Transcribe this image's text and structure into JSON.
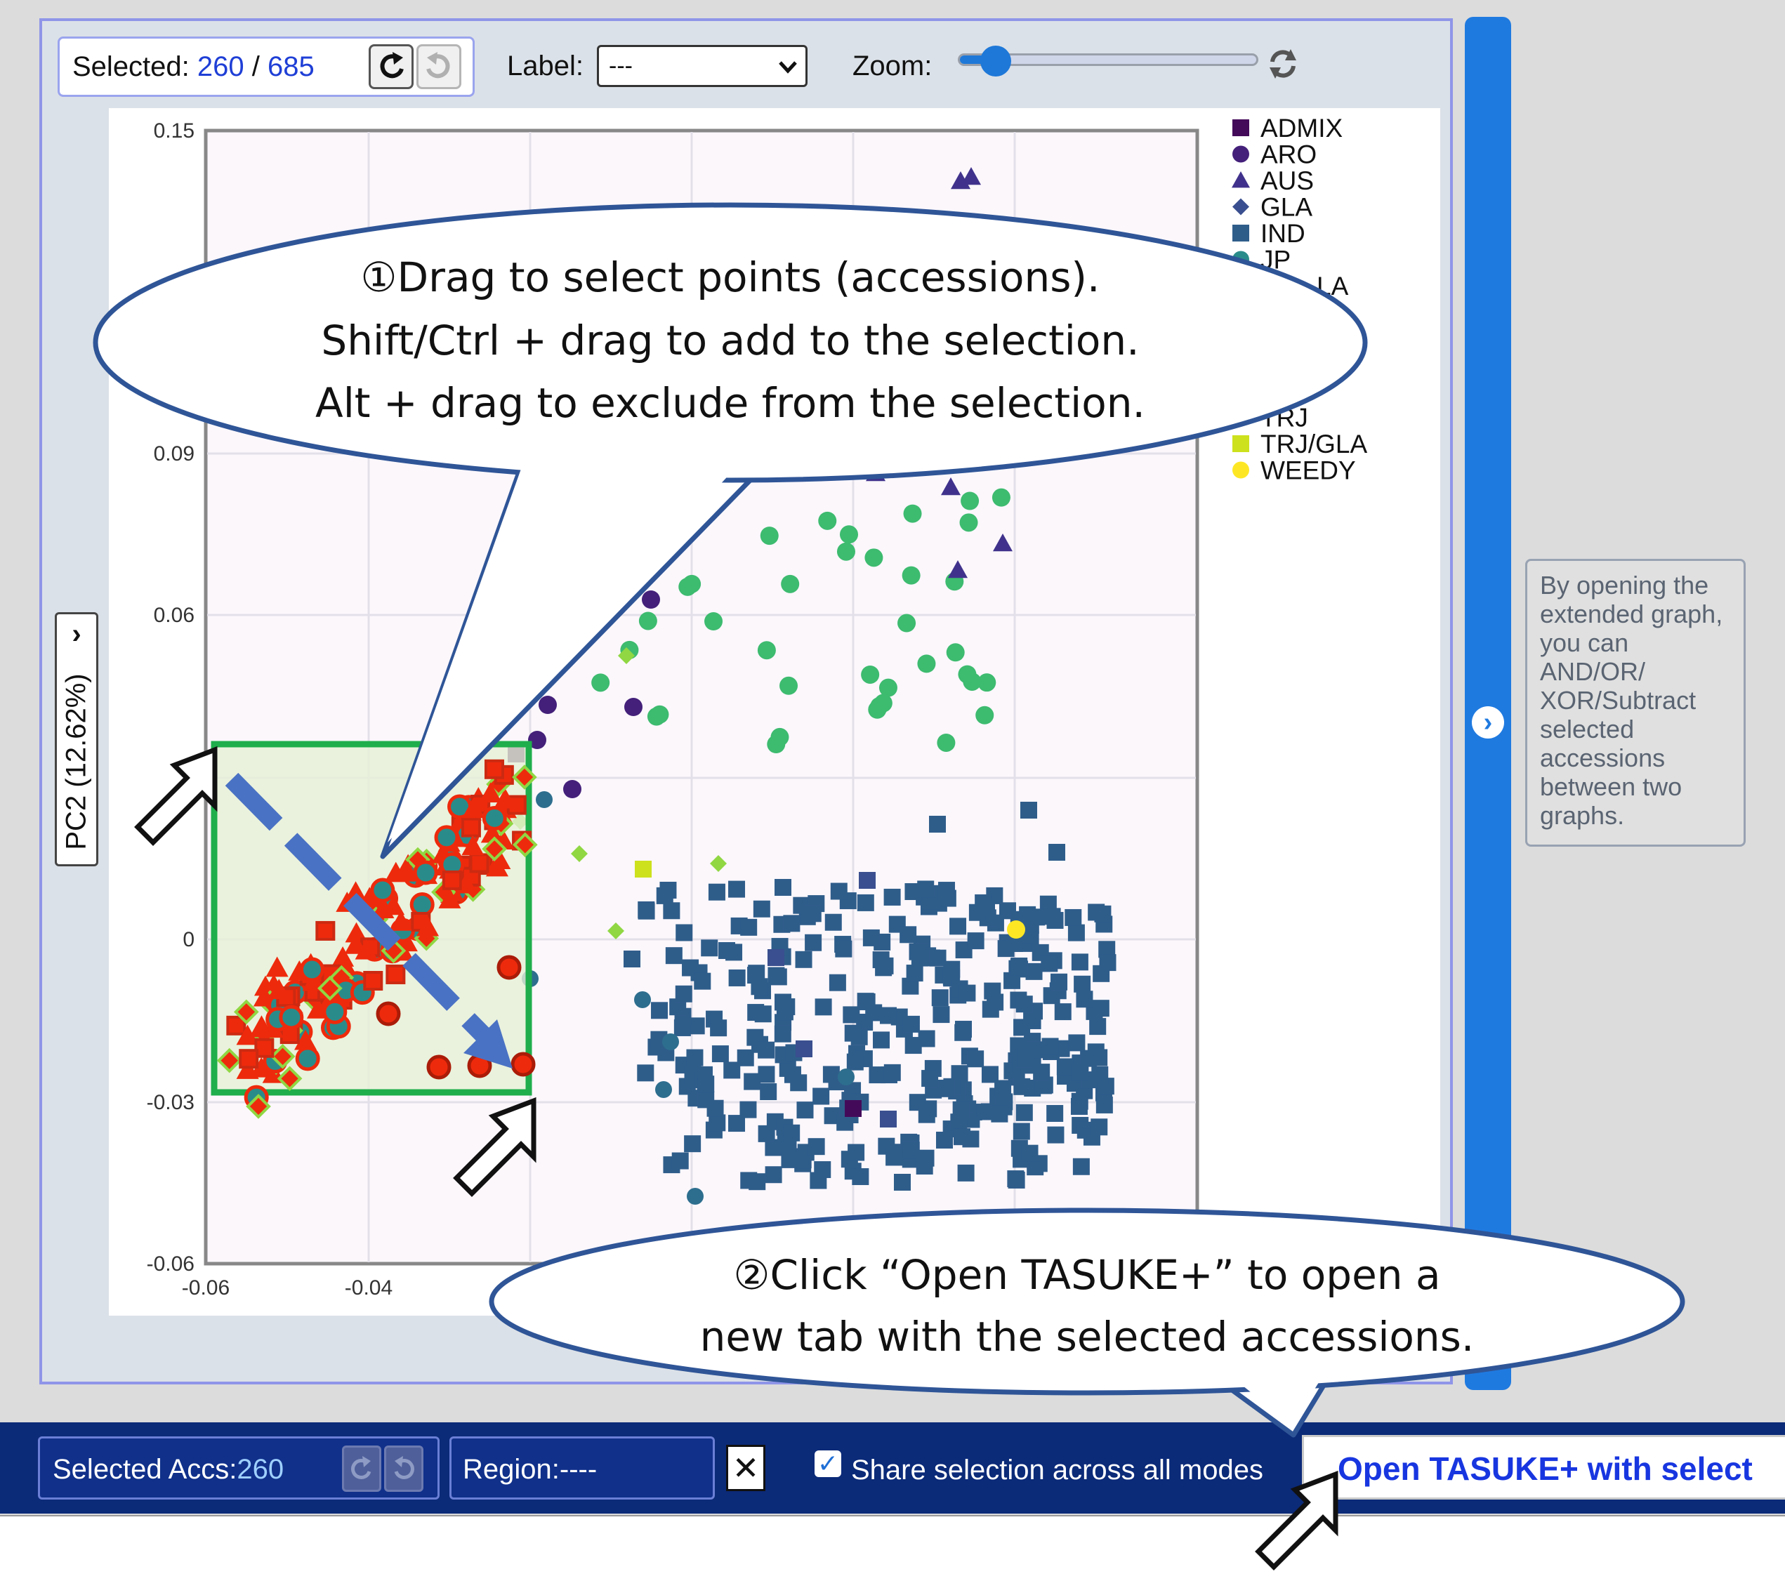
{
  "toolbar": {
    "selected_label": "Selected:",
    "selected_count": "260",
    "separator": "/",
    "selected_total": "685",
    "label_label": "Label:",
    "label_value": "---",
    "zoom_label": "Zoom:",
    "zoom_level": 0.12
  },
  "pc_axis": {
    "label": "PC2 (12.62%)"
  },
  "chart_data": {
    "type": "scatter",
    "yticks": [
      "0.15",
      "0.09",
      "0.06",
      "0",
      "-0.03",
      "-0.06"
    ],
    "xticks": [
      "-0.06",
      "-0.04"
    ],
    "legend": [
      "ADMIX",
      "ARO",
      "AUS",
      "GLA",
      "IND",
      "JP",
      "TRJ",
      "TRJ/GLA",
      "WEEDY"
    ],
    "legend_fragments": [
      "LA",
      "J"
    ],
    "colors": {
      "ADMIX": "#440a5a",
      "ARO": "#44207a",
      "AUS": "#40328c",
      "GLA": "#3a4f8f",
      "IND": "#2f5d8a",
      "JP": "#2a8c8a",
      "TRJ": "#90d743",
      "TRJ/GLA": "#cde11d",
      "WEEDY": "#fde725",
      "selected": "#ee2a0c",
      "greens": "#3dbb6f"
    },
    "selection_rect": {
      "x_min": -0.06,
      "x_max": -0.021,
      "y_max": 0.035,
      "y_min": -0.028
    }
  },
  "hint": {
    "text": "By opening the\nextended graph,\nyou can\nAND/OR/\nXOR/Subtract\nselected\naccessions\nbetween two\ngraphs."
  },
  "bottom": {
    "acc_label": "Selected Accs:",
    "acc_count": "260",
    "region_label": "Region:----",
    "share_label": "Share selection across all modes",
    "open_label": "Open TASUKE+ with select"
  },
  "callouts": {
    "first": [
      "①Drag to select points (accessions).",
      "Shift/Ctrl + drag to add to the selection.",
      "Alt + drag to exclude from the selection."
    ],
    "second": [
      "②Click “Open TASUKE+” to open a",
      "new tab with the selected accessions."
    ]
  }
}
